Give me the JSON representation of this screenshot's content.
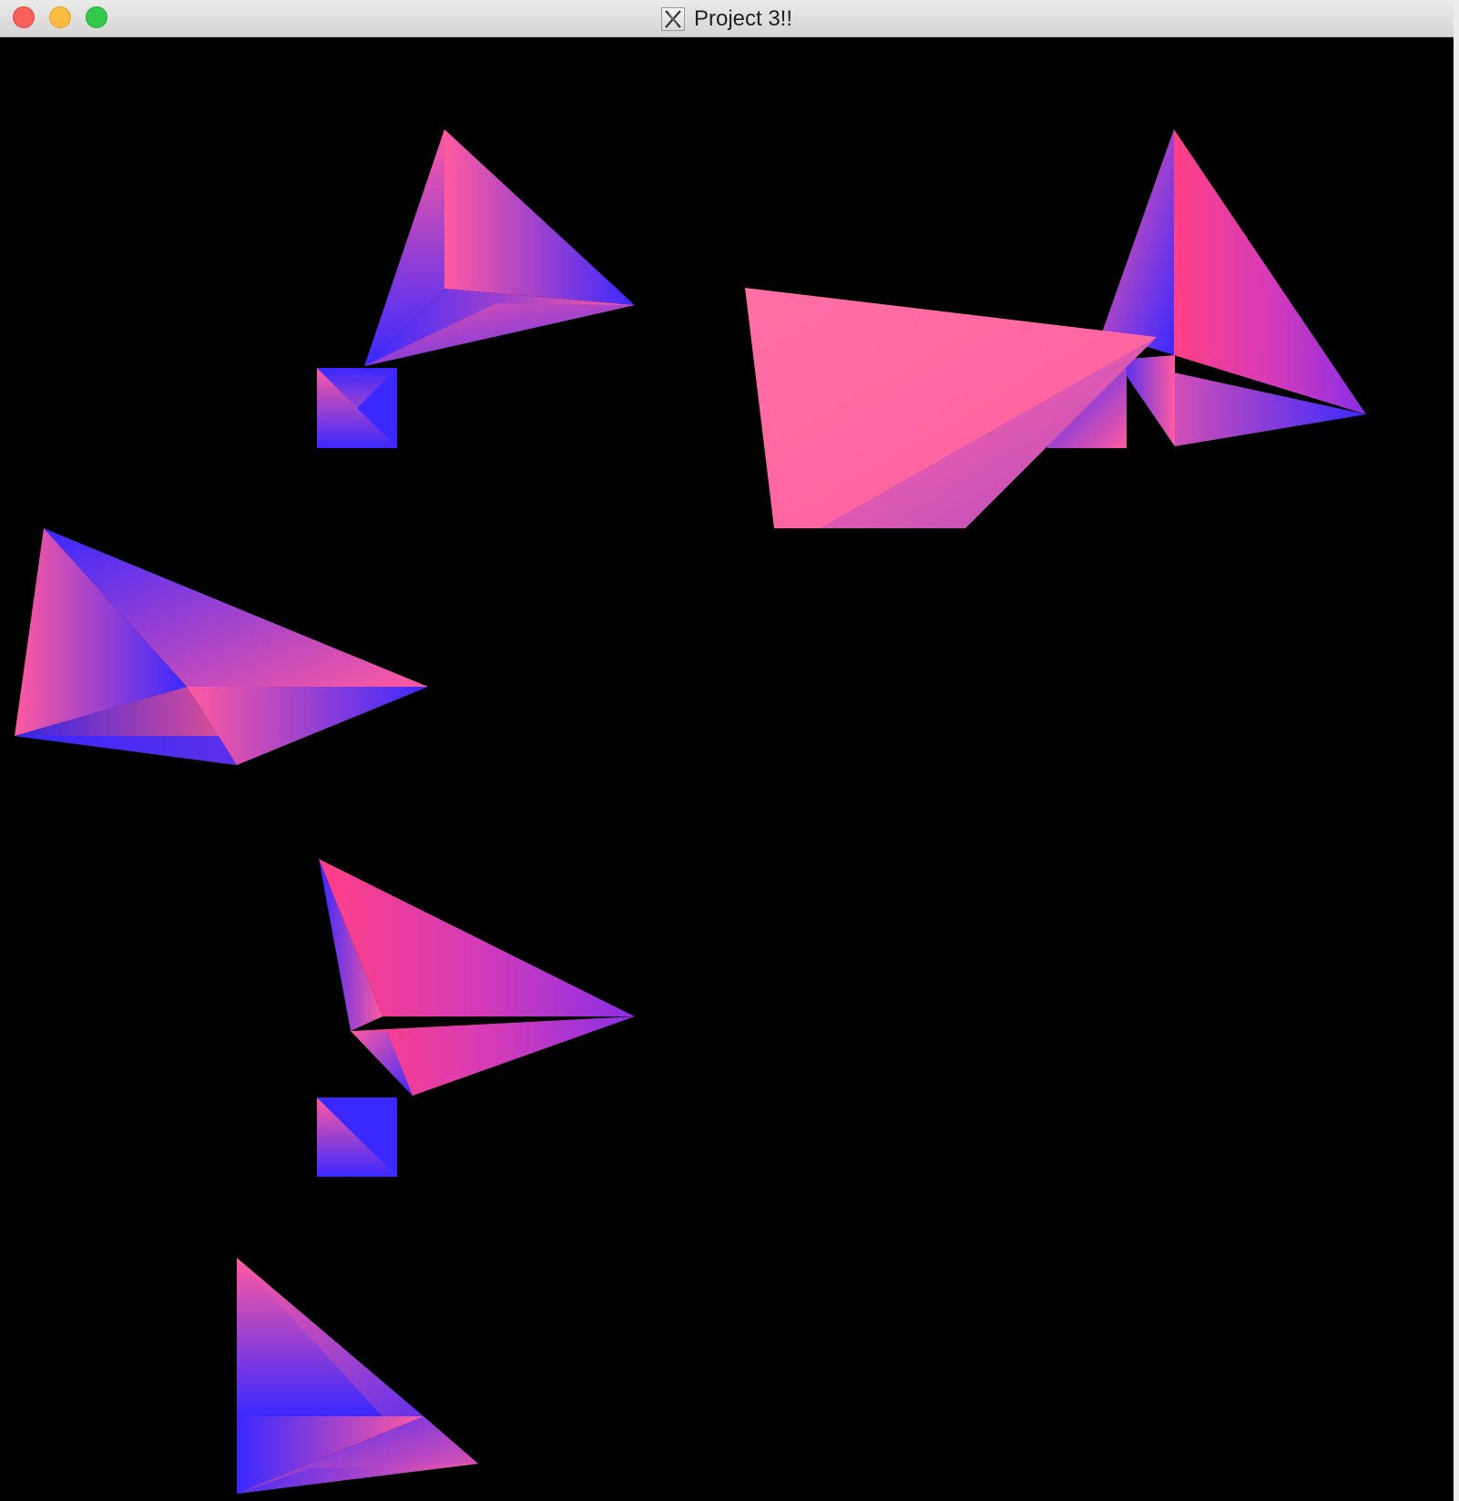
{
  "window": {
    "title": "Project 3!!",
    "title_icon": "x11-icon",
    "buttons": [
      "close",
      "minimize",
      "zoom"
    ]
  },
  "canvas": {
    "background": "#000000",
    "colors": {
      "pink": "#ff5aa0",
      "blue": "#3a28ff",
      "magenta": "#b23cd2"
    }
  }
}
